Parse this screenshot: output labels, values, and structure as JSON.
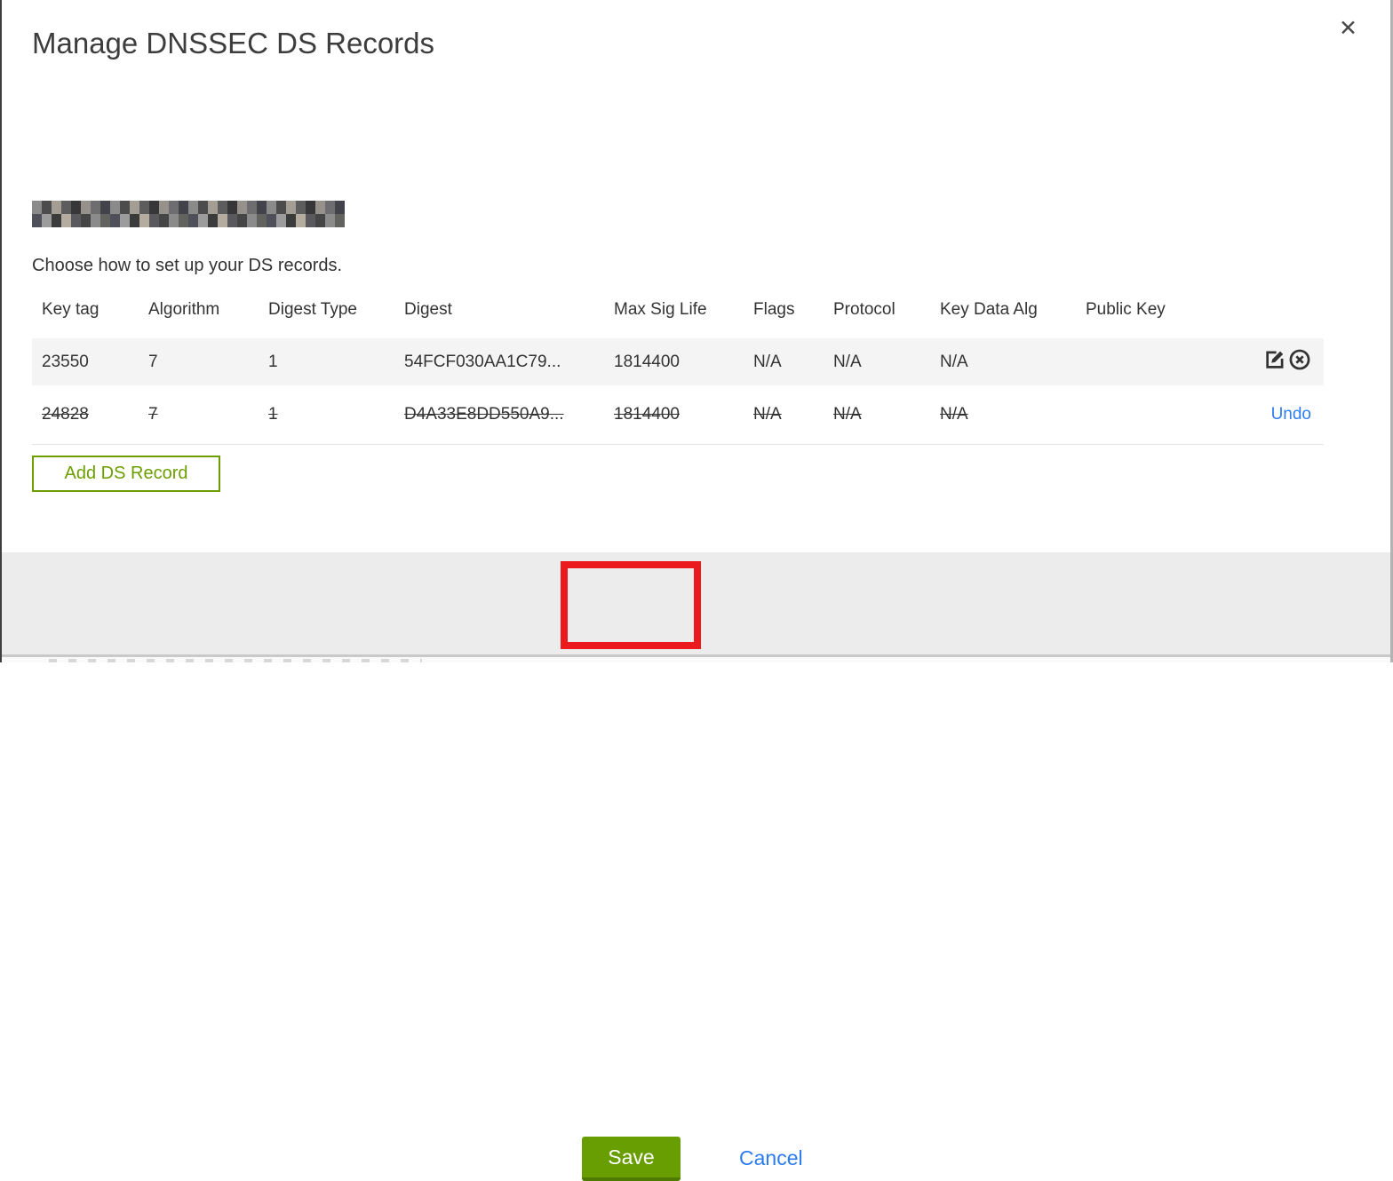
{
  "dialog": {
    "title": "Manage DNSSEC DS Records",
    "close_glyph": "✕",
    "instruction": "Choose how to set up your DS records."
  },
  "table": {
    "columns": [
      "Key tag",
      "Algorithm",
      "Digest Type",
      "Digest",
      "Max Sig Life",
      "Flags",
      "Protocol",
      "Key Data Alg",
      "Public Key"
    ],
    "rows": [
      {
        "key_tag": "23550",
        "algorithm": "7",
        "digest_type": "1",
        "digest": "54FCF030AA1C79...",
        "max_sig_life": "1814400",
        "flags": "N/A",
        "protocol": "N/A",
        "key_data_alg": "N/A",
        "public_key": "",
        "state": "current"
      },
      {
        "key_tag": "24828",
        "algorithm": "7",
        "digest_type": "1",
        "digest": "D4A33E8DD550A9...",
        "max_sig_life": "1814400",
        "flags": "N/A",
        "protocol": "N/A",
        "key_data_alg": "N/A",
        "public_key": "",
        "state": "deleted",
        "undo_label": "Undo"
      }
    ]
  },
  "buttons": {
    "add_ds_record": "Add DS Record",
    "save": "Save",
    "cancel": "Cancel"
  },
  "colors": {
    "green_button": "#689e02",
    "green_button_shadow": "#4e7a00",
    "green_outline": "#6c9e00",
    "link_blue": "#2d7ef2",
    "annotation_red": "#eb1b1d",
    "footer_gray": "#ececec",
    "row_gray": "#f4f4f4"
  }
}
